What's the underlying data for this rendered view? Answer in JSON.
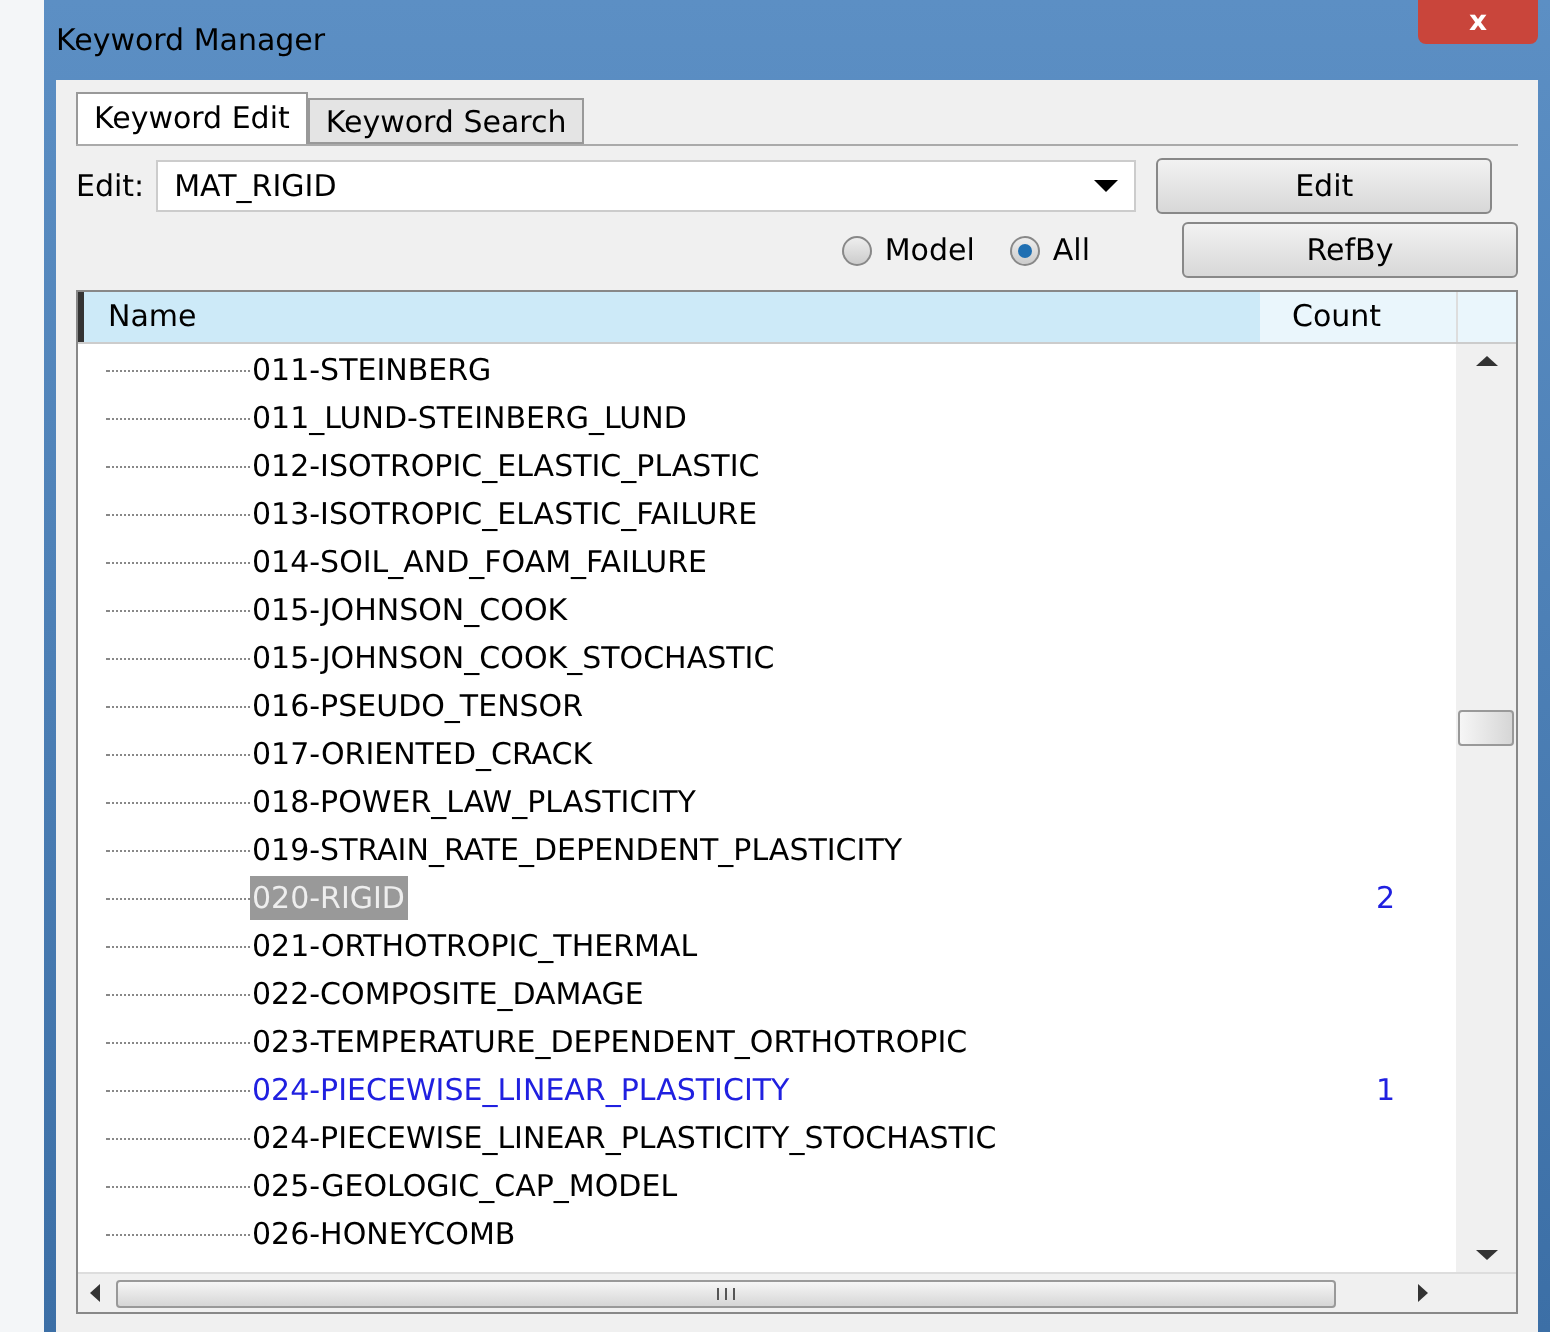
{
  "window": {
    "title": "Keyword Manager",
    "close": "x"
  },
  "tabs": [
    {
      "label": "Keyword Edit",
      "selected": true
    },
    {
      "label": "Keyword Search",
      "selected": false
    }
  ],
  "edit": {
    "label": "Edit:",
    "value": "MAT_RIGID"
  },
  "buttons": [
    "Edit",
    "RefBy"
  ],
  "scope": [
    {
      "label": "Model",
      "selected": false
    },
    {
      "label": "All",
      "selected": true
    }
  ],
  "table": {
    "columns": [
      "Name",
      "Count"
    ],
    "rows": [
      {
        "name": "011-STEINBERG",
        "selected": false,
        "used": false
      },
      {
        "name": "011_LUND-STEINBERG_LUND",
        "selected": false,
        "used": false
      },
      {
        "name": "012-ISOTROPIC_ELASTIC_PLASTIC",
        "selected": false,
        "used": false
      },
      {
        "name": "013-ISOTROPIC_ELASTIC_FAILURE",
        "selected": false,
        "used": false
      },
      {
        "name": "014-SOIL_AND_FOAM_FAILURE",
        "selected": false,
        "used": false
      },
      {
        "name": "015-JOHNSON_COOK",
        "selected": false,
        "used": false
      },
      {
        "name": "015-JOHNSON_COOK_STOCHASTIC",
        "selected": false,
        "used": false
      },
      {
        "name": "016-PSEUDO_TENSOR",
        "selected": false,
        "used": false
      },
      {
        "name": "017-ORIENTED_CRACK",
        "selected": false,
        "used": false
      },
      {
        "name": "018-POWER_LAW_PLASTICITY",
        "selected": false,
        "used": false
      },
      {
        "name": "019-STRAIN_RATE_DEPENDENT_PLASTICITY",
        "selected": false,
        "used": false
      },
      {
        "name": "020-RIGID",
        "count": "2",
        "selected": true,
        "used": true
      },
      {
        "name": "021-ORTHOTROPIC_THERMAL",
        "selected": false,
        "used": false
      },
      {
        "name": "022-COMPOSITE_DAMAGE",
        "selected": false,
        "used": false
      },
      {
        "name": "023-TEMPERATURE_DEPENDENT_ORTHOTROPIC",
        "selected": false,
        "used": false
      },
      {
        "name": "024-PIECEWISE_LINEAR_PLASTICITY",
        "count": "1",
        "selected": false,
        "used": true
      },
      {
        "name": "024-PIECEWISE_LINEAR_PLASTICITY_STOCHASTIC",
        "selected": false,
        "used": false
      },
      {
        "name": "025-GEOLOGIC_CAP_MODEL",
        "selected": false,
        "used": false
      },
      {
        "name": "026-HONEYCOMB",
        "selected": false,
        "used": false
      }
    ]
  }
}
